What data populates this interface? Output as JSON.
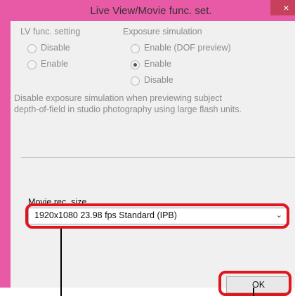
{
  "window": {
    "title": "Live View/Movie func. set.",
    "close_glyph": "×"
  },
  "lv_func": {
    "heading": "LV func. setting",
    "options": [
      "Disable",
      "Enable"
    ]
  },
  "exposure_sim": {
    "heading": "Exposure simulation",
    "options": [
      "Enable (DOF preview)",
      "Enable",
      "Disable"
    ],
    "selected": "Enable"
  },
  "description": [
    "Disable exposure simulation when previewing subject",
    "depth-of-field in studio photography using large flash units."
  ],
  "movie": {
    "label": "Movie rec. size",
    "value": "1920x1080  23.98 fps Standard (IPB)"
  },
  "ok_label": "OK",
  "colors": {
    "frame": "#e85aa6",
    "highlight": "#e0161e",
    "close": "#c7405c"
  }
}
